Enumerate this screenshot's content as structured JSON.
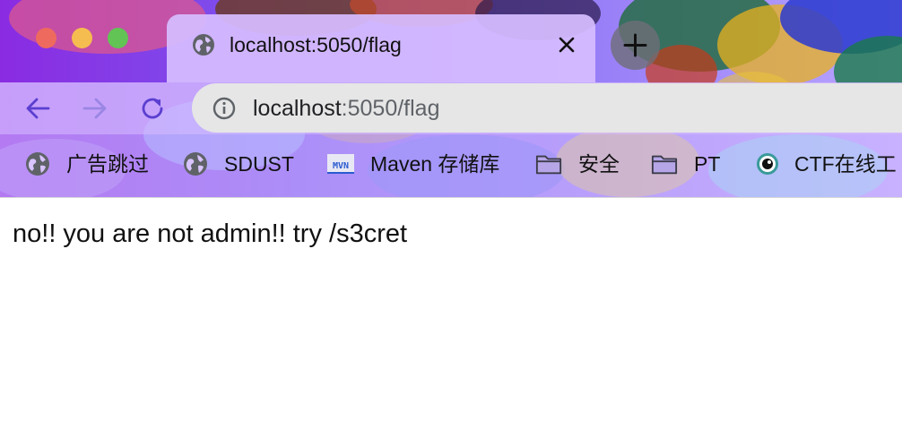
{
  "tab": {
    "title": "localhost:5050/flag",
    "favicon": "globe-icon",
    "close_icon": "close-icon"
  },
  "toolbar": {
    "url_host": "localhost",
    "url_path": ":5050/flag",
    "site_info_icon": "info-icon"
  },
  "bookmarks": [
    {
      "label": "广告跳过",
      "icon": "globe-icon"
    },
    {
      "label": "SDUST",
      "icon": "globe-icon"
    },
    {
      "label": "Maven 存储库",
      "icon": "mvn-logo-icon"
    },
    {
      "label": "安全",
      "icon": "folder-icon"
    },
    {
      "label": "PT",
      "icon": "folder-icon"
    },
    {
      "label": "CTF在线工",
      "icon": "ctf-logo-icon"
    }
  ],
  "page": {
    "message": "no!! you are not admin!! try /s3cret"
  },
  "colors": {
    "traffic_red": "#ee6a5e",
    "traffic_yellow": "#f5bd4f",
    "traffic_green": "#61c454",
    "theme_accent": "#5b3fd0",
    "omnibox_bg": "#e6e6e6"
  }
}
